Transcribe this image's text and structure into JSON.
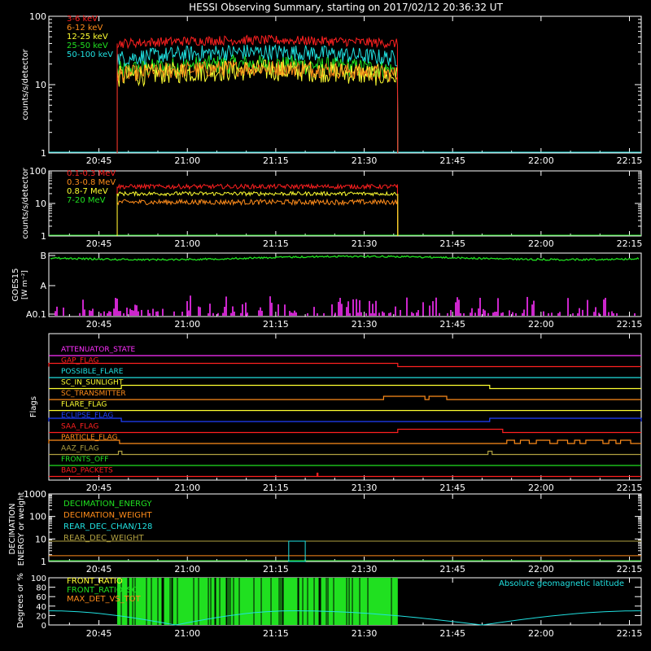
{
  "title": "HESSI Observing Summary, starting on 2017/02/12 20:36:32 UT",
  "colors": {
    "red": "#ff2020",
    "orange": "#ff8c1a",
    "yellow": "#ffff30",
    "green": "#20e020",
    "cyan": "#20e0e0",
    "magenta": "#ff30ff",
    "blue": "#2040ff",
    "olive": "#b0a040",
    "axis": "#ffffff"
  },
  "time_axis": {
    "start_min": 1236.5,
    "end_min": 1337,
    "tick_minutes": [
      1245,
      1260,
      1275,
      1290,
      1305,
      1320,
      1335
    ],
    "tick_labels": [
      "20:45",
      "21:00",
      "21:15",
      "21:30",
      "21:45",
      "22:00",
      "22:15"
    ]
  },
  "chart_data": [
    {
      "type": "line",
      "id": "low-energy-rates",
      "ylabel": "counts/s/detector",
      "yscale": "log",
      "ylim": [
        1,
        100
      ],
      "y_tick_labels": [
        "1",
        "10",
        "100"
      ],
      "x_range_min": [
        1248.1,
        1295.7
      ],
      "series": [
        {
          "name": "3-6 keV",
          "level": 40,
          "noise": 0.07,
          "color": "red"
        },
        {
          "name": "6-12 keV",
          "level": 14,
          "noise": 0.12,
          "color": "orange"
        },
        {
          "name": "12-25 keV",
          "level": 13,
          "noise": 0.16,
          "color": "yellow"
        },
        {
          "name": "25-50 keV",
          "level": 16,
          "noise": 0.14,
          "color": "green"
        },
        {
          "name": "50-100 keV",
          "level": 24,
          "noise": 0.12,
          "color": "cyan"
        }
      ]
    },
    {
      "type": "line",
      "id": "high-energy-rates",
      "ylabel": "counts/s/detector",
      "yscale": "log",
      "ylim": [
        1,
        100
      ],
      "y_tick_labels": [
        "1",
        "10",
        "100"
      ],
      "x_range_min": [
        1248.1,
        1295.7
      ],
      "series": [
        {
          "name": "0.1-0.3 MeV",
          "level": 33,
          "noise": 0.07,
          "color": "red"
        },
        {
          "name": "0.3-0.8 MeV",
          "level": 11,
          "noise": 0.08,
          "color": "orange"
        },
        {
          "name": "0.8-7 MeV",
          "level": 20,
          "noise": 0.06,
          "color": "yellow"
        },
        {
          "name": "7-20 MeV",
          "level": 1,
          "noise": 0.0,
          "color": "green"
        }
      ]
    },
    {
      "type": "line",
      "id": "goes",
      "ylabel": "GOES15",
      "yunit": "[W m⁻²]",
      "y_tick_labels": [
        "A0.1",
        "A",
        "B"
      ],
      "series": [
        {
          "name": "goes-long",
          "level": "B",
          "color": "green"
        },
        {
          "name": "goes-short",
          "level": "A0.1",
          "color": "magenta"
        }
      ]
    },
    {
      "type": "flags",
      "id": "flags",
      "ylabel": "Flags",
      "series": [
        {
          "name": "ATTENUATOR_STATE",
          "color": "magenta",
          "on": []
        },
        {
          "name": "GAP_FLAG",
          "color": "red",
          "on": [
            [
              1236.5,
              1295.7
            ]
          ]
        },
        {
          "name": "POSSIBLE_FLARE",
          "color": "cyan",
          "on": []
        },
        {
          "name": "SC_IN_SUNLIGHT",
          "color": "yellow",
          "on": [
            [
              1248.8,
              1311.3
            ]
          ]
        },
        {
          "name": "SC_TRANSMITTER",
          "color": "orange",
          "on": [
            [
              1293.3,
              1300.3
            ],
            [
              1301.0,
              1304.0
            ]
          ]
        },
        {
          "name": "FLARE_FLAG",
          "color": "yellow",
          "on": []
        },
        {
          "name": "ECLIPSE_FLAG",
          "color": "blue",
          "on": [
            [
              1236.5,
              1248.8
            ],
            [
              1311.3,
              1337
            ]
          ]
        },
        {
          "name": "SAA_FLAG",
          "color": "red",
          "on": [
            [
              1295.7,
              1313.5
            ]
          ]
        },
        {
          "name": "PARTICLE_FLAG",
          "color": "orange",
          "on": [
            [
              1236.5,
              1248.5
            ],
            [
              1314.2,
              1315.5
            ],
            [
              1316.5,
              1318.0
            ],
            [
              1319.2,
              1321.5
            ],
            [
              1322.8,
              1324.5
            ],
            [
              1325.7,
              1326.6
            ],
            [
              1327.6,
              1330.5
            ],
            [
              1331.5,
              1332.7
            ],
            [
              1333.5,
              1335.2
            ]
          ]
        },
        {
          "name": "AAZ_FLAG",
          "color": "olive",
          "on": [
            [
              1248.3,
              1248.9
            ],
            [
              1311.0,
              1311.7
            ]
          ]
        },
        {
          "name": "FRONTS_OFF",
          "color": "green",
          "on": []
        },
        {
          "name": "BAD_PACKETS",
          "color": "red",
          "on": [
            [
              1282.0,
              1282.15
            ]
          ]
        }
      ]
    },
    {
      "type": "line",
      "id": "decimation",
      "ylabel": "DECIMATION ENERGY or weight",
      "yscale": "log",
      "ylim": [
        1,
        1000
      ],
      "y_tick_labels": [
        "1",
        "10",
        "100",
        "1000"
      ],
      "series": [
        {
          "name": "DECIMATION_ENERGY",
          "color": "green",
          "level": 1
        },
        {
          "name": "DECIMATION_WEIGHT",
          "color": "orange",
          "level": 1.8
        },
        {
          "name": "REAR_DEC_CHAN/128",
          "color": "cyan",
          "level": 8,
          "x_range_min": [
            1277.2,
            1280.0
          ]
        },
        {
          "name": "REAR_DEC_WEIGHT",
          "color": "olive",
          "level": 8
        }
      ]
    },
    {
      "type": "bar",
      "id": "ratios",
      "ylabel": "Degrees or %",
      "ylim": [
        0,
        100
      ],
      "y_tick_labels": [
        "0",
        "20",
        "40",
        "60",
        "80",
        "100"
      ],
      "annotation": "Absolute geomagnetic latitude",
      "x_range_min": [
        1248.1,
        1295.7
      ],
      "series": [
        {
          "name": "FRONT_RATIO",
          "color": "yellow"
        },
        {
          "name": "FRONT_RATIO_SC",
          "color": "green"
        },
        {
          "name": "MAX_DET_VS_TOT",
          "color": "orange"
        }
      ],
      "latitude_series": {
        "color": "cyan",
        "peaks_min": [
          1236.5,
          1278,
          1337
        ],
        "troughs_min": [
          1258,
          1310
        ],
        "peak_deg": 30,
        "trough_deg": 0
      }
    }
  ]
}
